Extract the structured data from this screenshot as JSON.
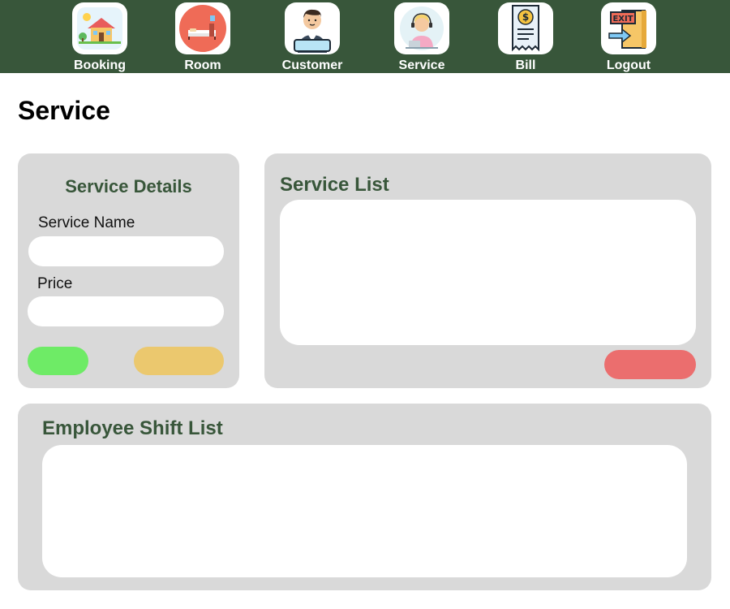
{
  "nav": {
    "items": [
      {
        "label": "Booking",
        "icon": "house-icon"
      },
      {
        "label": "Room",
        "icon": "bed-icon"
      },
      {
        "label": "Customer",
        "icon": "client-icon"
      },
      {
        "label": "Service",
        "icon": "support-agent-icon"
      },
      {
        "label": "Bill",
        "icon": "receipt-icon"
      },
      {
        "label": "Logout",
        "icon": "exit-icon"
      }
    ]
  },
  "page": {
    "title": "Service"
  },
  "service_details": {
    "title": "Service Details",
    "name_label": "Service Name",
    "name_value": "",
    "price_label": "Price",
    "price_value": ""
  },
  "service_list": {
    "title": "Service List"
  },
  "employee_shift": {
    "title": "Employee Shift List"
  },
  "colors": {
    "topbar": "#38563a",
    "panel": "#d9d9d9",
    "heading": "#38563a",
    "add_button": "#6eeb66",
    "update_button": "#ebc86e",
    "delete_button": "#eb6e6e"
  }
}
